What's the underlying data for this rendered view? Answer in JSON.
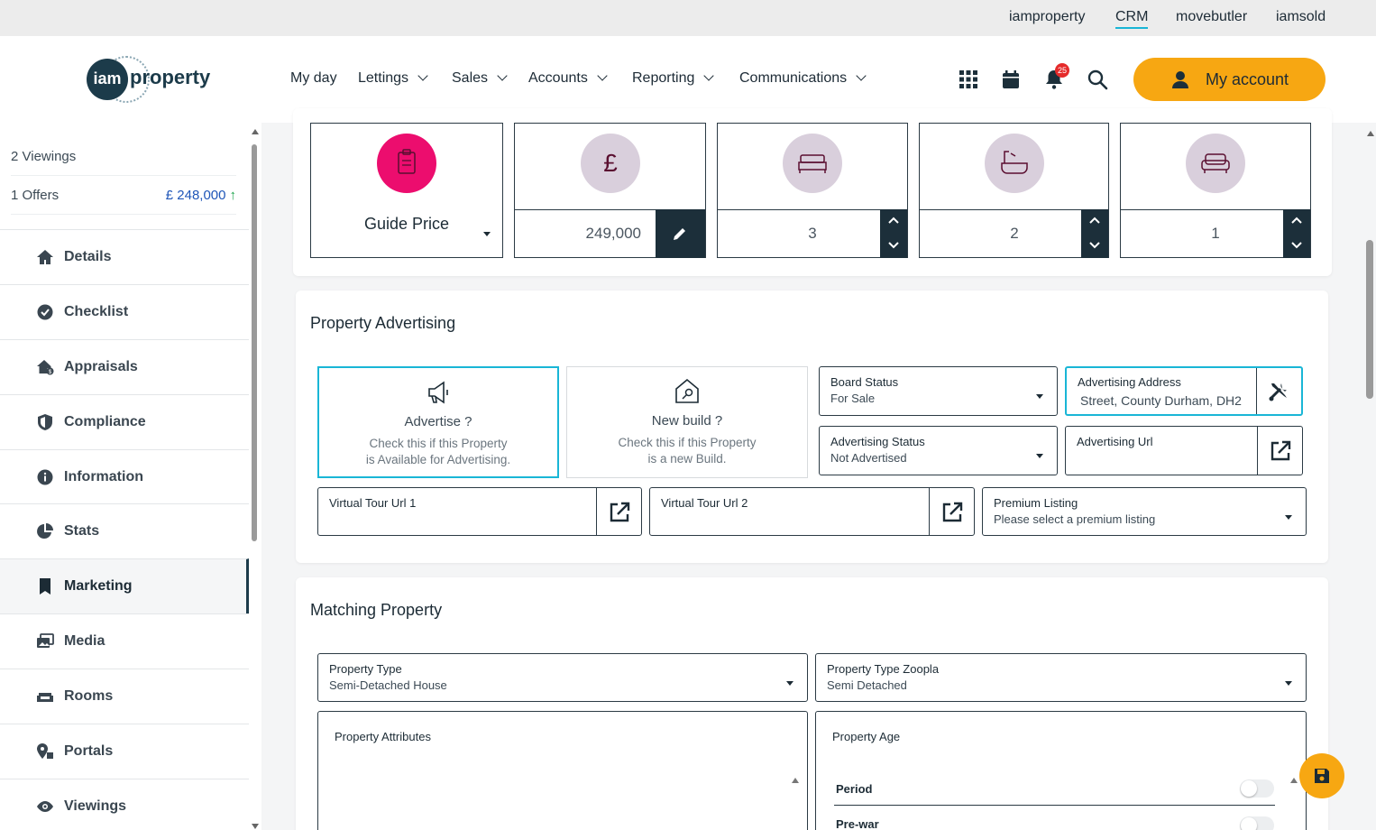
{
  "top_links": [
    "iamproperty",
    "CRM",
    "movebutler",
    "iamsold"
  ],
  "logo": {
    "circle_text": "iam",
    "word": "property"
  },
  "nav": {
    "items": [
      "My day",
      "Lettings",
      "Sales",
      "Accounts",
      "Reporting",
      "Communications"
    ]
  },
  "header": {
    "notification_count": "25",
    "account_label": "My account"
  },
  "sidebar": {
    "viewings_summary": "2 Viewings",
    "offers_summary": "1 Offers",
    "offers_value": "£ 248,000",
    "offers_trend": "↑",
    "items": [
      {
        "label": "Details",
        "icon": "home-icon"
      },
      {
        "label": "Checklist",
        "icon": "check-circle-icon"
      },
      {
        "label": "Appraisals",
        "icon": "house-money-icon"
      },
      {
        "label": "Compliance",
        "icon": "shield-icon"
      },
      {
        "label": "Information",
        "icon": "info-icon"
      },
      {
        "label": "Stats",
        "icon": "pie-chart-icon"
      },
      {
        "label": "Marketing",
        "icon": "bookmark-icon"
      },
      {
        "label": "Media",
        "icon": "images-icon"
      },
      {
        "label": "Rooms",
        "icon": "sofa-icon"
      },
      {
        "label": "Portals",
        "icon": "portal-icon"
      },
      {
        "label": "Viewings",
        "icon": "eye-icon"
      }
    ],
    "active": "Marketing"
  },
  "price_panel": {
    "guide_label": "Guide Price",
    "price_value": "249,000",
    "bedrooms": "3",
    "bathrooms": "2",
    "receptions": "1"
  },
  "advertising": {
    "title": "Property Advertising",
    "advertise_title": "Advertise ?",
    "advertise_desc_1": "Check this if this Property",
    "advertise_desc_2": "is Available for Advertising.",
    "newbuild_title": "New build ?",
    "newbuild_desc_1": "Check this if this Property",
    "newbuild_desc_2": "is a new Build.",
    "board_status_label": "Board Status",
    "board_status_value": "For Sale",
    "adv_address_label": "Advertising Address",
    "adv_address_value": "Street, County Durham, DH2",
    "adv_status_label": "Advertising Status",
    "adv_status_value": "Not Advertised",
    "adv_url_label": "Advertising Url",
    "vt1_label": "Virtual Tour Url 1",
    "vt2_label": "Virtual Tour Url 2",
    "premium_label": "Premium Listing",
    "premium_placeholder": "Please select a premium listing"
  },
  "matching": {
    "title": "Matching Property",
    "type_label": "Property Type",
    "type_value": "Semi-Detached House",
    "zoopla_label": "Property Type Zoopla",
    "zoopla_value": "Semi Detached",
    "attributes_label": "Property Attributes",
    "age_label": "Property Age",
    "age_options": [
      "Period",
      "Pre-war"
    ]
  },
  "colors": {
    "accent": "#f7a712",
    "dark": "#1c2f3a",
    "pink": "#ec0d6e",
    "highlight": "#19b6d6",
    "mauve": "#d9cfdc"
  }
}
